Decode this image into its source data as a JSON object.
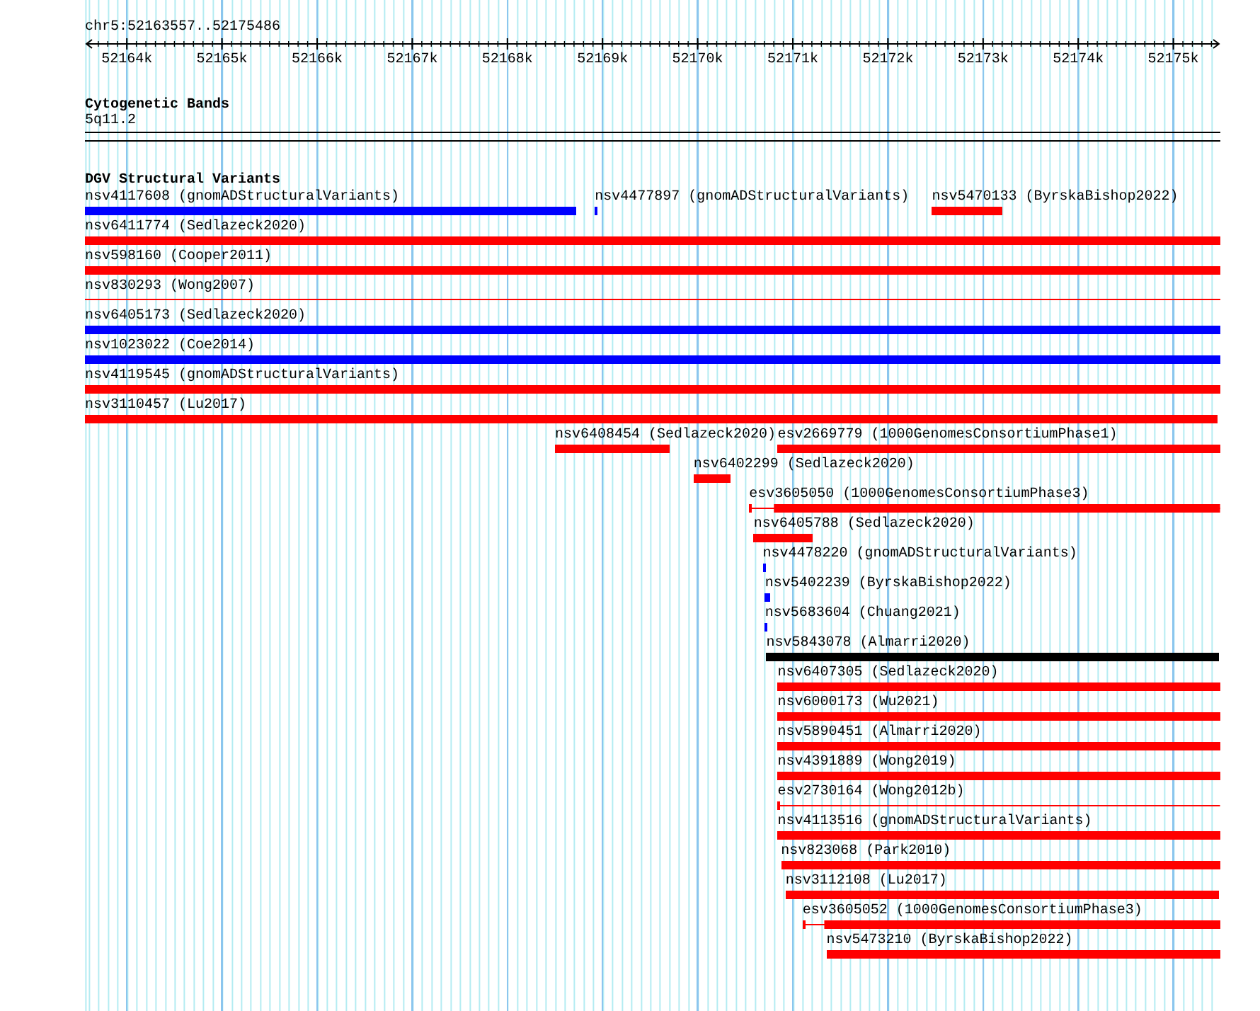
{
  "ruler": {
    "title": "chr5:52163557..52175486",
    "ticks": [
      "52164k",
      "52165k",
      "52166k",
      "52167k",
      "52168k",
      "52169k",
      "52170k",
      "52171k",
      "52172k",
      "52173k",
      "52174k",
      "52175k"
    ]
  },
  "cytogenetic_bands": {
    "title": "Cytogenetic Bands",
    "band": "5q11.2"
  },
  "dgv": {
    "title": "DGV Structural Variants",
    "rows": [
      [
        {
          "label": "nsv4117608 (gnomADStructuralVariants)",
          "kind": "block",
          "color": "#0000ff"
        },
        {
          "label": "nsv4477897 (gnomADStructuralVariants)",
          "kind": "block",
          "color": "#0000ff"
        },
        {
          "label": "nsv5470133 (ByrskaBishop2022)",
          "kind": "block",
          "color": "#ff0000"
        }
      ],
      [
        {
          "label": "nsv6411774 (Sedlazeck2020)",
          "kind": "block",
          "color": "#ff0000"
        }
      ],
      [
        {
          "label": "nsv598160 (Cooper2011)",
          "kind": "block",
          "color": "#ff0000"
        }
      ],
      [
        {
          "label": "nsv830293 (Wong2007)",
          "kind": "line",
          "color": "#ff0000"
        }
      ],
      [
        {
          "label": "nsv6405173 (Sedlazeck2020)",
          "kind": "block",
          "color": "#0000ff"
        }
      ],
      [
        {
          "label": "nsv1023022 (Coe2014)",
          "kind": "block",
          "color": "#0000ff"
        }
      ],
      [
        {
          "label": "nsv4119545 (gnomADStructuralVariants)",
          "kind": "block",
          "color": "#ff0000"
        }
      ],
      [
        {
          "label": "nsv3110457 (Lu2017)",
          "kind": "block",
          "color": "#ff0000"
        }
      ],
      [
        {
          "label": "nsv6408454 (Sedlazeck2020)",
          "kind": "block",
          "color": "#ff0000"
        },
        {
          "label": "esv2669779 (1000GenomesConsortiumPhase1)",
          "kind": "block",
          "color": "#ff0000"
        }
      ],
      [
        {
          "label": "nsv6402299 (Sedlazeck2020)",
          "kind": "block",
          "color": "#ff0000"
        }
      ],
      [
        {
          "label": "esv3605050 (1000GenomesConsortiumPhase3)",
          "kind": "split",
          "color": "#ff0000"
        }
      ],
      [
        {
          "label": "nsv6405788 (Sedlazeck2020)",
          "kind": "block",
          "color": "#ff0000"
        }
      ],
      [
        {
          "label": "nsv4478220 (gnomADStructuralVariants)",
          "kind": "block",
          "color": "#0000ff"
        }
      ],
      [
        {
          "label": "nsv5402239 (ByrskaBishop2022)",
          "kind": "block",
          "color": "#0000ff"
        }
      ],
      [
        {
          "label": "nsv5683604 (Chuang2021)",
          "kind": "block",
          "color": "#0000ff"
        }
      ],
      [
        {
          "label": "nsv5843078 (Almarri2020)",
          "kind": "block",
          "color": "#000000"
        }
      ],
      [
        {
          "label": "nsv6407305 (Sedlazeck2020)",
          "kind": "block",
          "color": "#ff0000"
        }
      ],
      [
        {
          "label": "nsv6000173 (Wu2021)",
          "kind": "block",
          "color": "#ff0000"
        }
      ],
      [
        {
          "label": "nsv5890451 (Almarri2020)",
          "kind": "block",
          "color": "#ff0000"
        }
      ],
      [
        {
          "label": "nsv4391889 (Wong2019)",
          "kind": "block",
          "color": "#ff0000"
        }
      ],
      [
        {
          "label": "esv2730164 (Wong2012b)",
          "kind": "split",
          "color": "#ff0000"
        }
      ],
      [
        {
          "label": "nsv4113516 (gnomADStructuralVariants)",
          "kind": "block",
          "color": "#ff0000"
        }
      ],
      [
        {
          "label": "nsv823068 (Park2010)",
          "kind": "block",
          "color": "#ff0000"
        }
      ],
      [
        {
          "label": "nsv3112108 (Lu2017)",
          "kind": "block",
          "color": "#ff0000"
        }
      ],
      [
        {
          "label": "esv3605052 (1000GenomesConsortiumPhase3)",
          "kind": "split",
          "color": "#ff0000"
        }
      ],
      [
        {
          "label": "nsv5473210 (ByrskaBishop2022)",
          "kind": "block",
          "color": "#ff0000"
        }
      ]
    ]
  }
}
